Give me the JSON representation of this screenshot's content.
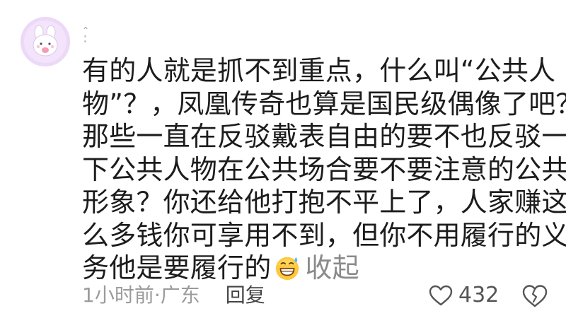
{
  "comment": {
    "lines": [
      "有的人就是抓不到重点，什么叫“公共人",
      "物”？，凤凰传奇也算是国民级偶像了吧？",
      "那些一直在反驳戴表自由的要不也反驳一",
      "下公共人物在公共场合要不要注意的公共",
      "形象？你还给他打抱不平上了，人家赚这",
      "么多钱你可享用不到，但你不用履行的义",
      "务他是要履行的"
    ],
    "emoji": "grinning-sweat-emoji",
    "collapse_label": "收起"
  },
  "meta": {
    "time_location": "1小时前·广东",
    "reply_label": "回复"
  },
  "actions": {
    "like_count": "432",
    "like_icon": "heart-outline-icon",
    "dislike_icon": "broken-heart-outline-icon"
  },
  "avatar": {
    "icon": "bunny-avatar-icon",
    "bg_color": "#ead9f7"
  }
}
